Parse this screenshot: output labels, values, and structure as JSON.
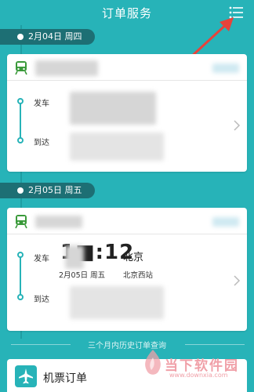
{
  "header": {
    "title": "订单服务"
  },
  "orders": [
    {
      "date": "2月04日 周四",
      "depart_label": "发车",
      "arrive_label": "到达"
    },
    {
      "date": "2月05日 周五",
      "depart_label": "发车",
      "arrive_label": "到达",
      "depart_time": "1■:12",
      "depart_city": "北京",
      "depart_date": "2月05日 周五",
      "depart_station": "北京西站"
    }
  ],
  "history": {
    "label": "三个月内历史订单查询"
  },
  "flight": {
    "label": "机票订单"
  },
  "watermark": {
    "text": "当下软件园",
    "sub": "www.downxia.com"
  },
  "colors": {
    "background": "#27b3b8",
    "date_pill": "#1d6f74",
    "accent": "#27b3b8",
    "arrow": "#e8433a"
  },
  "icons": [
    "menu-list-icon",
    "train-icon",
    "chevron-right-icon",
    "plane-icon"
  ]
}
